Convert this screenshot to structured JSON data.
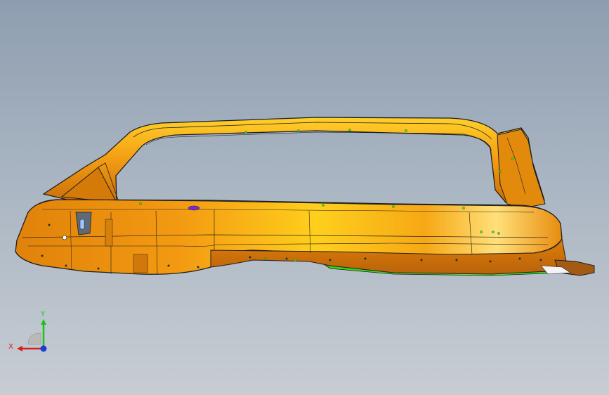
{
  "viewport": {
    "background_top": "#8e9db0",
    "background_bottom": "#c7cdd3"
  },
  "model": {
    "part_color": "#f39a12",
    "part_highlight": "#ffd21a",
    "part_shadow": "#c86a06",
    "edge_color": "#1e1e1e",
    "inner_panel_color": "#38e01c",
    "feature_color": "#7a2bd6"
  },
  "triad": {
    "x_label": "X",
    "y_label": "Y",
    "x_color": "#d81e1e",
    "y_color": "#19c219",
    "z_color": "#1d3bd6"
  }
}
